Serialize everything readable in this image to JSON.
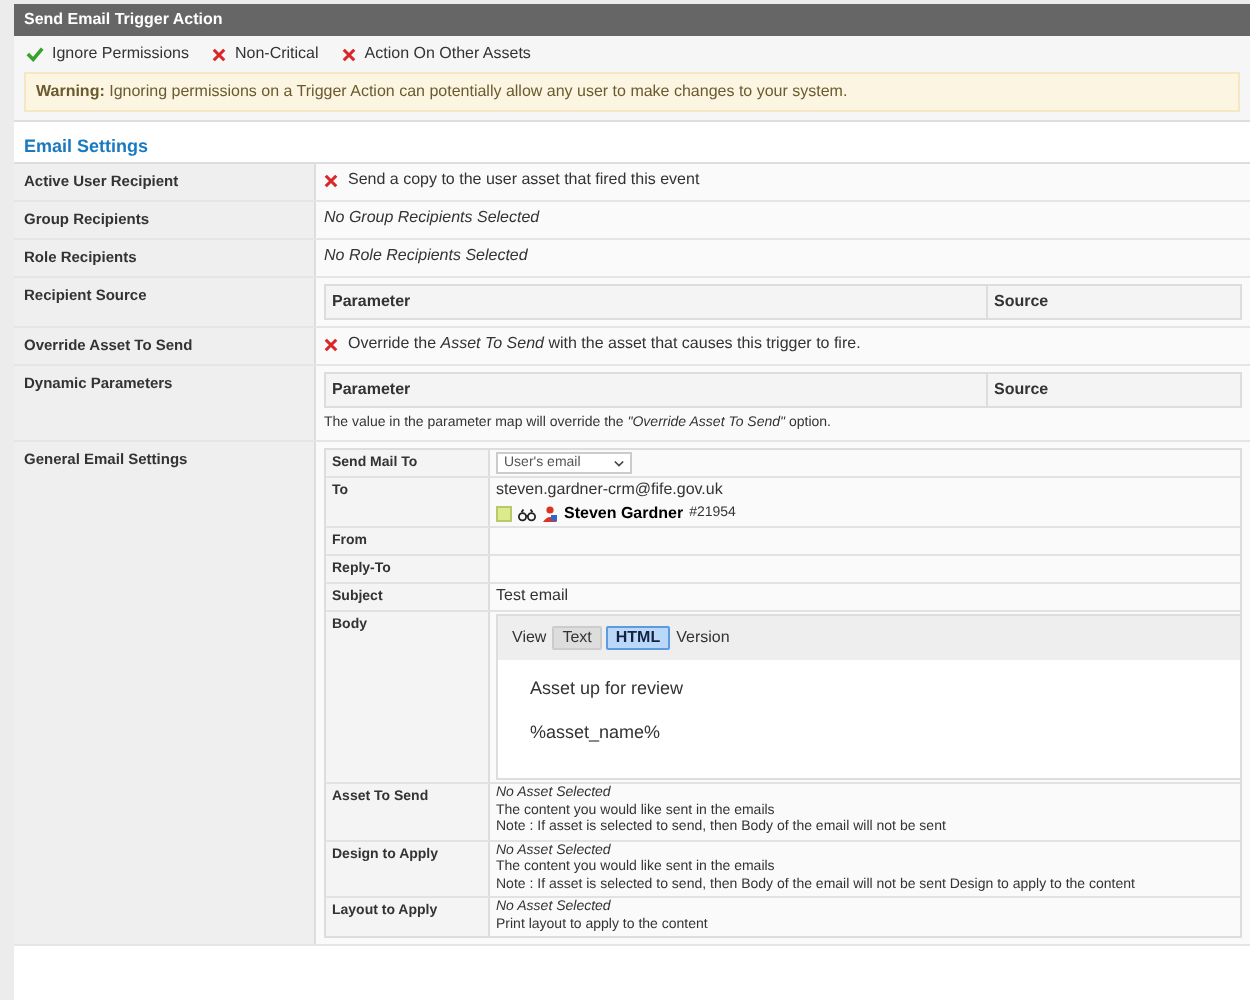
{
  "header": {
    "title": "Send Email Trigger Action"
  },
  "flags": [
    {
      "label": "Ignore Permissions",
      "checked": true
    },
    {
      "label": "Non-Critical",
      "checked": false
    },
    {
      "label": "Action On Other Assets",
      "checked": false
    }
  ],
  "warning": {
    "label": "Warning:",
    "text": "Ignoring permissions on a Trigger Action can potentially allow any user to make changes to your system."
  },
  "section_title": "Email Settings",
  "rows": [
    {
      "kind": "toggle",
      "label": "Active User Recipient",
      "checked": false,
      "text": "Send a copy to the user asset that fired this event"
    },
    {
      "kind": "text",
      "label": "Group Recipients",
      "value": "No Group Recipients Selected"
    },
    {
      "kind": "text",
      "label": "Role Recipients",
      "value": "No Role Recipients Selected"
    },
    {
      "kind": "param_table",
      "label": "Recipient Source",
      "columns": [
        "Parameter",
        "Source"
      ]
    },
    {
      "kind": "toggle",
      "label": "Override Asset To Send",
      "checked": false,
      "text": "Override the *Asset To Send* with the asset that causes this trigger to fire."
    },
    {
      "kind": "param_table",
      "label": "Dynamic Parameters",
      "columns": [
        "Parameter",
        "Source"
      ],
      "note": "The value in the parameter map will override the *\"Override Asset To Send\"* option."
    },
    {
      "kind": "settings",
      "label": "General Email Settings",
      "fields": [
        {
          "kind": "select",
          "label": "Send Mail To",
          "value": "User's email"
        },
        {
          "kind": "recipient",
          "label": "To",
          "email": "steven.gardner-crm@fife.gov.uk",
          "user_name": "Steven Gardner",
          "user_id": "#21954"
        },
        {
          "kind": "text",
          "label": "From"
        },
        {
          "kind": "text",
          "label": "Reply-To"
        },
        {
          "kind": "text",
          "label": "Subject",
          "value": "Test email"
        },
        {
          "kind": "editor",
          "label": "Body",
          "view_label": "View",
          "tabs": [
            {
              "label": "Text",
              "selected": false
            },
            {
              "label": "HTML",
              "selected": true
            }
          ],
          "version_label": "Version",
          "lines": [
            "Asset up for review",
            "%asset_name%"
          ]
        },
        {
          "kind": "asset",
          "label": "Asset To Send",
          "status": "No Asset Selected",
          "lines": [
            "The content you would like sent in the emails",
            "Note : If asset is selected to send, then Body of the email will not be sent"
          ]
        },
        {
          "kind": "asset",
          "label": "Design to Apply",
          "status": "No Asset Selected",
          "lines": [
            "The content you would like sent in the emails",
            "Note : If asset is selected to send, then Body of the email will not be sent Design to apply to the content"
          ]
        },
        {
          "kind": "asset",
          "label": "Layout to Apply",
          "status": "No Asset Selected",
          "lines": [
            "Print layout to apply to the content"
          ]
        }
      ]
    }
  ]
}
